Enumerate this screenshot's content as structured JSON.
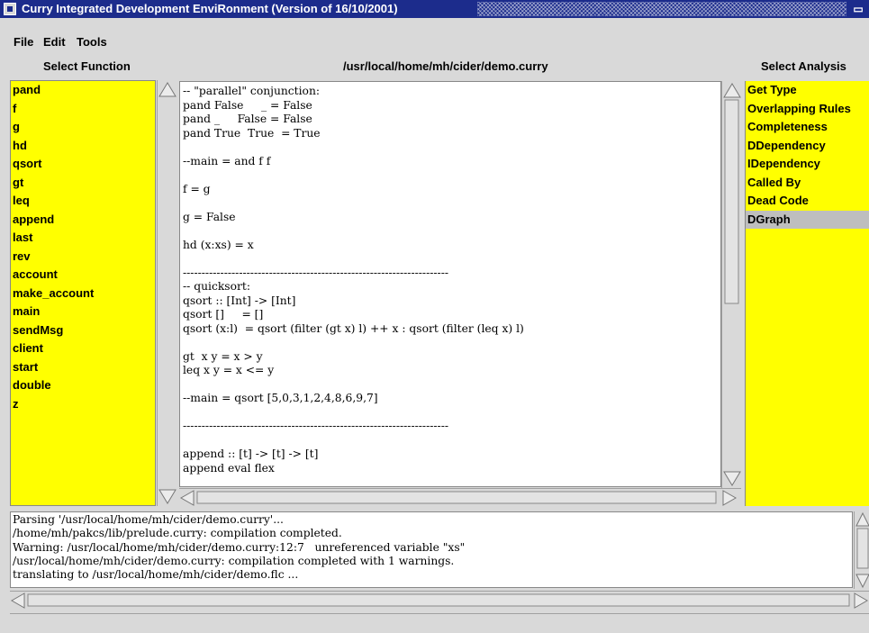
{
  "window": {
    "title": "Curry Integrated Development EnviRonment (Version of 16/10/2001)"
  },
  "menu": [
    "File",
    "Edit",
    "Tools"
  ],
  "headers": {
    "functions": "Select Function",
    "file_path": "/usr/local/home/mh/cider/demo.curry",
    "analysis": "Select Analysis"
  },
  "functions": [
    "pand",
    "f",
    "g",
    "hd",
    "qsort",
    "gt",
    "leq",
    "append",
    "last",
    "rev",
    "account",
    "make_account",
    "main",
    "sendMsg",
    "client",
    "start",
    "double",
    "z"
  ],
  "analyses": [
    {
      "label": "Get Type",
      "selected": false
    },
    {
      "label": "Overlapping Rules",
      "selected": false
    },
    {
      "label": "Completeness",
      "selected": false
    },
    {
      "label": "DDependency",
      "selected": false
    },
    {
      "label": "IDependency",
      "selected": false
    },
    {
      "label": "Called By",
      "selected": false
    },
    {
      "label": "Dead Code",
      "selected": false
    },
    {
      "label": "DGraph",
      "selected": true
    }
  ],
  "editor_lines": [
    "-- \"parallel\" conjunction:",
    "pand False     _ = False",
    "pand _     False = False",
    "pand True  True  = True",
    "",
    "--main = and f f",
    "",
    "f = g",
    "",
    "g = False",
    "",
    "hd (x:xs) = x",
    "",
    "-----------------------------------------------------------------------",
    "-- quicksort:",
    "qsort :: [Int] -> [Int]",
    "qsort []     = []",
    "qsort (x:l)  = qsort (filter (gt x) l) ++ x : qsort (filter (leq x) l)",
    "",
    "gt  x y = x > y",
    "leq x y = x <= y",
    "",
    "--main = qsort [5,0,3,1,2,4,8,6,9,7]",
    "",
    "-----------------------------------------------------------------------",
    "",
    "append :: [t] -> [t] -> [t]",
    "append eval flex"
  ],
  "log_lines": [
    "Parsing '/usr/local/home/mh/cider/demo.curry'...",
    "/home/mh/pakcs/lib/prelude.curry: compilation completed.",
    "Warning: /usr/local/home/mh/cider/demo.curry:12:7   unreferenced variable \"xs\"",
    "/usr/local/home/mh/cider/demo.curry: compilation completed with 1 warnings.",
    "translating to /usr/local/home/mh/cider/demo.flc ..."
  ]
}
